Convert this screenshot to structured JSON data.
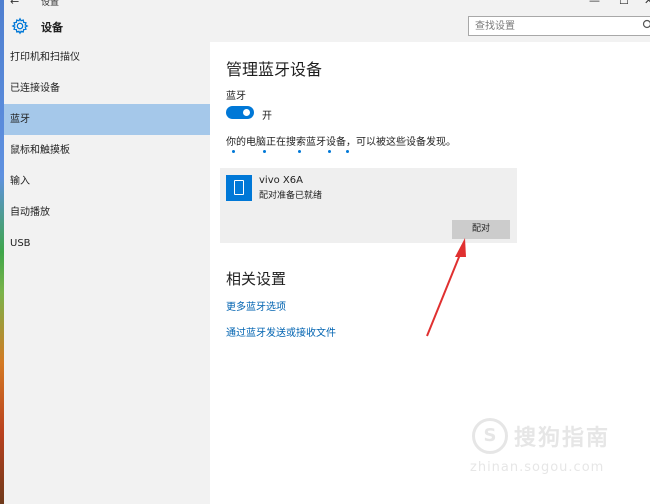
{
  "window": {
    "back_icon": "←",
    "title": "设置",
    "minimize_icon": "—",
    "maximize_icon": "☐",
    "close_icon": "✕"
  },
  "header": {
    "icon": "gear-icon",
    "title": "设备",
    "search_placeholder": "查找设置",
    "search_icon": "search-icon"
  },
  "sidebar": {
    "items": [
      {
        "label": "打印机和扫描仪",
        "selected": false
      },
      {
        "label": "已连接设备",
        "selected": false
      },
      {
        "label": "蓝牙",
        "selected": true
      },
      {
        "label": "鼠标和触摸板",
        "selected": false
      },
      {
        "label": "输入",
        "selected": false
      },
      {
        "label": "自动播放",
        "selected": false
      },
      {
        "label": "USB",
        "selected": false
      }
    ]
  },
  "main": {
    "title": "管理蓝牙设备",
    "bluetooth_label": "蓝牙",
    "toggle_state": "开",
    "toggle_on": true,
    "discover_text": "你的电脑正在搜索蓝牙设备，可以被这些设备发现。",
    "device": {
      "icon": "phone-icon",
      "name": "vivo X6A",
      "status": "配对准备已就绪",
      "pair_label": "配对"
    },
    "related_title": "相关设置",
    "links": [
      "更多蓝牙选项",
      "通过蓝牙发送或接收文件"
    ]
  },
  "watermark": {
    "symbol": "S",
    "brand": "搜狗指南",
    "url": "zhinan.sogou.com"
  },
  "colors": {
    "accent": "#0078d7",
    "selected_bg": "#a5c8ea",
    "panel_bg": "#f2f2f2",
    "annotation_arrow": "#e03030"
  }
}
